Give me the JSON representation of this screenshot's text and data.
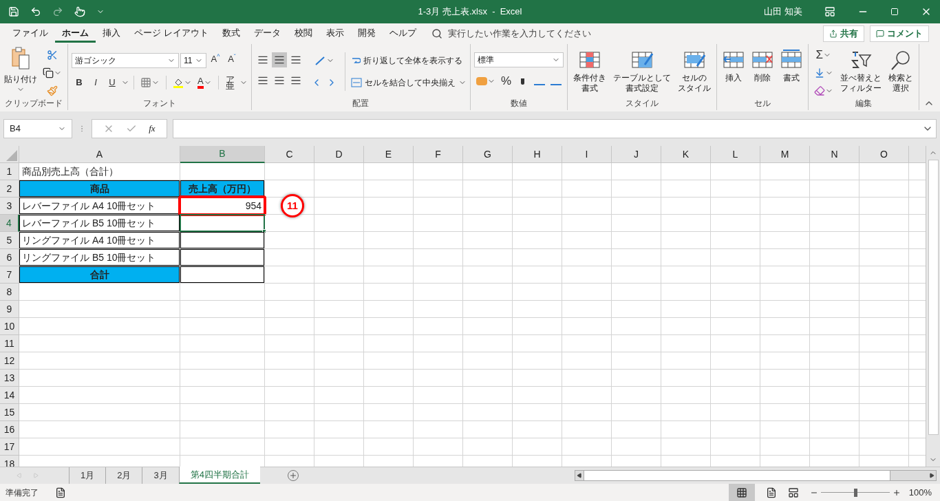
{
  "title_bar": {
    "title": "1-3月 売上表.xlsx  -  Excel",
    "user": "山田 知美"
  },
  "menu": {
    "tabs": [
      {
        "label": "ファイル",
        "selected": false
      },
      {
        "label": "ホーム",
        "selected": true
      },
      {
        "label": "挿入",
        "selected": false
      },
      {
        "label": "ページ レイアウト",
        "selected": false
      },
      {
        "label": "数式",
        "selected": false
      },
      {
        "label": "データ",
        "selected": false
      },
      {
        "label": "校閲",
        "selected": false
      },
      {
        "label": "表示",
        "selected": false
      },
      {
        "label": "開発",
        "selected": false
      },
      {
        "label": "ヘルプ",
        "selected": false
      }
    ],
    "search": {
      "placeholder": "実行したい作業を入力してください"
    },
    "share": "共有",
    "comment": "コメント"
  },
  "ribbon": {
    "groups": [
      {
        "kind": "clipboard",
        "label": "クリップボード",
        "paste": "貼り付け"
      },
      {
        "kind": "font",
        "label": "フォント",
        "font": "游ゴシック",
        "size": "11",
        "grow": "A",
        "grow_mark": "^",
        "shrink": "A",
        "shrink_mark": "ˇ",
        "bold": "B",
        "italic": "I",
        "underline": "U",
        "font_color": "A",
        "phonetic_top": "ア",
        "phonetic_bottom": "亜"
      },
      {
        "kind": "alignment",
        "label": "配置",
        "vertical_align": [
          {
            "selected": false
          },
          {
            "selected": true
          },
          {
            "selected": false
          }
        ],
        "wrap": "折り返して全体を表示する",
        "merge": "セルを結合して中央揃え"
      },
      {
        "kind": "number",
        "label": "数値",
        "format": "標準",
        "percent": "%"
      },
      {
        "kind": "buttons",
        "label": "スタイル",
        "buttons": [
          {
            "kind": "conditional",
            "line1": "条件付き",
            "line2": "書式"
          },
          {
            "kind": "table",
            "line1": "テーブルとして",
            "line2": "書式設定"
          },
          {
            "kind": "style",
            "line1": "セルの",
            "line2": "スタイル"
          }
        ]
      },
      {
        "kind": "buttons",
        "label": "セル",
        "buttons": [
          {
            "kind": "insert",
            "line1": "挿入"
          },
          {
            "kind": "delete",
            "line1": "削除"
          },
          {
            "kind": "format",
            "line1": "書式"
          }
        ]
      },
      {
        "kind": "editing",
        "label": "編集",
        "sum": "Σ",
        "buttons": [
          {
            "kind": "sort",
            "line1": "並べ替えと",
            "line2": "フィルター"
          },
          {
            "kind": "find",
            "line1": "検索と",
            "line2": "選択"
          }
        ]
      }
    ]
  },
  "formula_bar": {
    "name_box": "B4",
    "fx": "fx"
  },
  "sheet": {
    "columns": [
      {
        "label": "A",
        "selected": false
      },
      {
        "label": "B",
        "selected": true
      },
      {
        "label": "C",
        "selected": false
      },
      {
        "label": "D",
        "selected": false
      },
      {
        "label": "E",
        "selected": false
      },
      {
        "label": "F",
        "selected": false
      },
      {
        "label": "G",
        "selected": false
      },
      {
        "label": "H",
        "selected": false
      },
      {
        "label": "I",
        "selected": false
      },
      {
        "label": "J",
        "selected": false
      },
      {
        "label": "K",
        "selected": false
      },
      {
        "label": "L",
        "selected": false
      },
      {
        "label": "M",
        "selected": false
      },
      {
        "label": "N",
        "selected": false
      },
      {
        "label": "O",
        "selected": false
      }
    ],
    "rows": [
      {
        "number": "1",
        "selected": false,
        "cells": [
          {
            "kind": "title",
            "text": "商品別売上高（合計）"
          }
        ]
      },
      {
        "number": "2",
        "selected": false,
        "cells": [
          {
            "kind": "header",
            "text": "商品"
          },
          {
            "kind": "header",
            "text": "売上高（万円）"
          }
        ]
      },
      {
        "number": "3",
        "selected": false,
        "callout": "11",
        "cells": [
          {
            "kind": "text",
            "text": "レバーファイル A4 10冊セット"
          },
          {
            "kind": "number",
            "text": "954",
            "marked": true
          }
        ]
      },
      {
        "number": "4",
        "selected": true,
        "cells": [
          {
            "kind": "text",
            "text": "レバーファイル B5 10冊セット"
          },
          {
            "kind": "number"
          }
        ]
      },
      {
        "number": "5",
        "selected": false,
        "cells": [
          {
            "kind": "text",
            "text": "リングファイル A4 10冊セット"
          },
          {
            "kind": "number"
          }
        ]
      },
      {
        "number": "6",
        "selected": false,
        "cells": [
          {
            "kind": "text",
            "text": "リングファイル B5 10冊セット"
          },
          {
            "kind": "number"
          }
        ]
      },
      {
        "number": "7",
        "selected": false,
        "cells": [
          {
            "kind": "header",
            "text": "合計"
          },
          {
            "kind": "number"
          }
        ]
      },
      {
        "number": "8",
        "selected": false,
        "cells": []
      },
      {
        "number": "9",
        "selected": false,
        "cells": []
      },
      {
        "number": "10",
        "selected": false,
        "cells": []
      },
      {
        "number": "11",
        "selected": false,
        "cells": []
      },
      {
        "number": "12",
        "selected": false,
        "cells": []
      },
      {
        "number": "13",
        "selected": false,
        "cells": []
      },
      {
        "number": "14",
        "selected": false,
        "cells": []
      },
      {
        "number": "15",
        "selected": false,
        "cells": []
      },
      {
        "number": "16",
        "selected": false,
        "cells": []
      },
      {
        "number": "17",
        "selected": false,
        "cells": []
      },
      {
        "number": "18",
        "selected": false,
        "cells": []
      }
    ]
  },
  "sheet_tabs": [
    {
      "label": "1月",
      "selected": false
    },
    {
      "label": "2月",
      "selected": false
    },
    {
      "label": "3月",
      "selected": false
    },
    {
      "label": "第4四半期合計",
      "selected": true
    }
  ],
  "status_bar": {
    "status": "準備完了",
    "zoom": "100%",
    "zoom_slider": {
      "level": 0.5
    }
  }
}
